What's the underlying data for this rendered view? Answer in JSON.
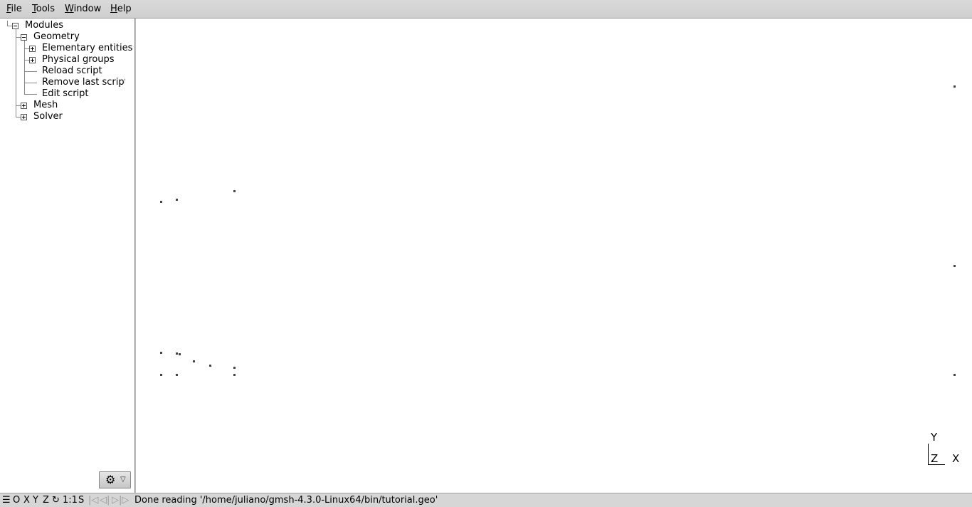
{
  "menubar": {
    "file": {
      "pre": "",
      "u": "F",
      "post": "ile"
    },
    "tools": {
      "pre": "",
      "u": "T",
      "post": "ools"
    },
    "window": {
      "pre": "",
      "u": "W",
      "post": "indow"
    },
    "help": {
      "pre": "",
      "u": "H",
      "post": "elp"
    }
  },
  "tree": {
    "modules": "Modules",
    "geometry": "Geometry",
    "elementary": "Elementary entities",
    "physical": "Physical groups",
    "reload": "Reload script",
    "remove": "Remove last script (",
    "edit": "Edit script",
    "mesh": "Mesh",
    "solver": "Solver"
  },
  "options_button": {
    "icon": "gear-icon",
    "glyph": "⚙",
    "arrow": "▽"
  },
  "axes": {
    "y": "Y",
    "z": "Z",
    "x": "X"
  },
  "statusbar": {
    "menu_icon": "☰",
    "o": "O",
    "x": "X",
    "y": "Y",
    "z": "Z",
    "rotate": "↻",
    "scale": "1:1",
    "s": "S",
    "first": "|◁",
    "prev": "◁|",
    "play": "▷",
    "last": "|▷",
    "message": "Done reading '/home/juliano/gmsh-4.3.0-Linux64/bin/tutorial.geo'"
  },
  "colors": {
    "menubar": "#d4d4d4",
    "statusbar": "#d6d6d6",
    "points": "#444444",
    "background": "#ffffff"
  }
}
